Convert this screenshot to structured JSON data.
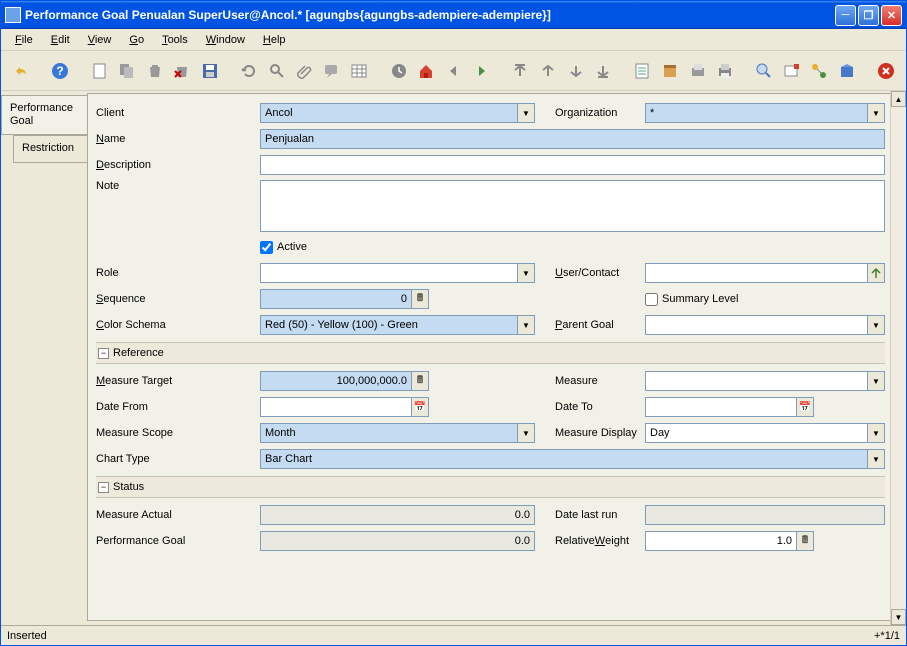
{
  "window": {
    "title": "Performance Goal  Penualan  SuperUser@Ancol.* [agungbs{agungbs-adempiere-adempiere}]"
  },
  "menu": {
    "file": "File",
    "edit": "Edit",
    "view": "View",
    "go": "Go",
    "tools": "Tools",
    "window": "Window",
    "help": "Help"
  },
  "tabs": {
    "perfgoal": "Performance Goal",
    "restriction": "Restriction"
  },
  "form": {
    "labels": {
      "client": "Client",
      "organization": "Organization",
      "name": "Name",
      "description": "Description",
      "note": "Note",
      "active": "Active",
      "role": "Role",
      "usercontact": "User/Contact",
      "sequence": "Sequence",
      "summarylevel": "Summary Level",
      "colorschema": "Color Schema",
      "parentgoal": "Parent Goal",
      "reference": "Reference",
      "measuretarget": "Measure Target",
      "measure": "Measure",
      "datefrom": "Date From",
      "dateto": "Date To",
      "measurescope": "Measure Scope",
      "measuredisplay": "Measure Display",
      "charttype": "Chart Type",
      "status": "Status",
      "measureactual": "Measure Actual",
      "datelastrun": "Date last run",
      "performancegoal": "Performance Goal",
      "relativeweight": "Relative Weight"
    },
    "values": {
      "client": "Ancol",
      "organization": "*",
      "name": "Penjualan",
      "description": "",
      "note": "",
      "active": true,
      "role": "",
      "usercontact": "",
      "sequence": "0",
      "summarylevel": false,
      "colorschema": "Red (50) - Yellow (100) - Green",
      "parentgoal": "",
      "measuretarget": "100,000,000.0",
      "measure": "",
      "datefrom": "",
      "dateto": "",
      "measurescope": "Month",
      "measuredisplay": "Day",
      "charttype": "Bar Chart",
      "measureactual": "0.0",
      "datelastrun": "",
      "performancegoal": "0.0",
      "relativeweight": "1.0"
    }
  },
  "status": {
    "left": "Inserted",
    "right": "+*1/1"
  }
}
